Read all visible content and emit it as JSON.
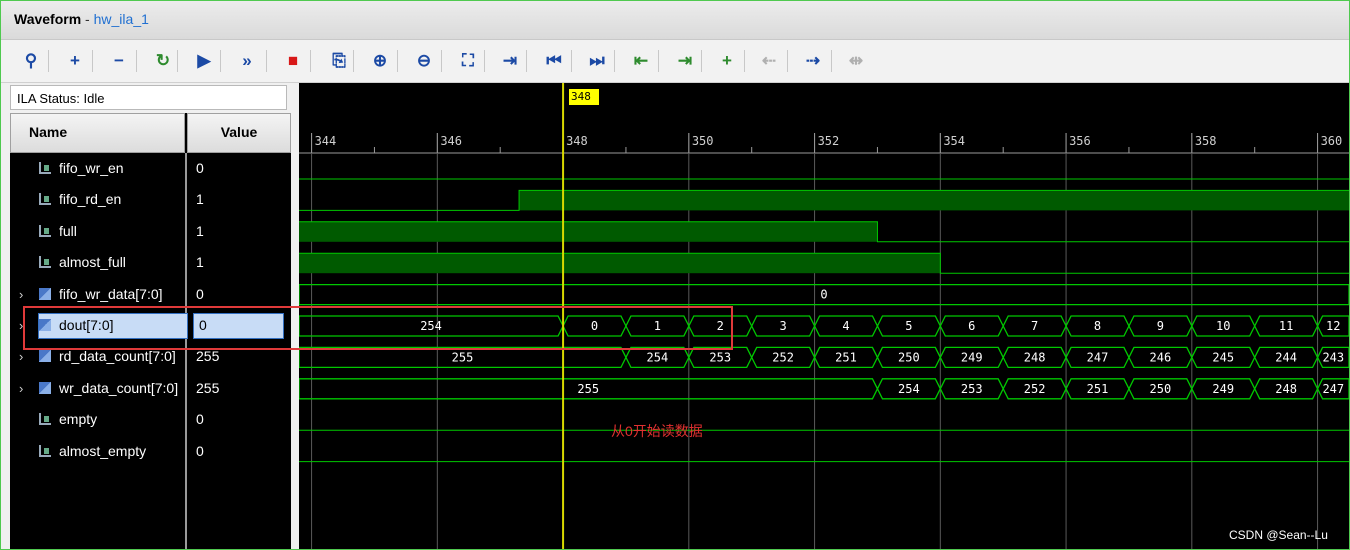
{
  "window": {
    "title": "Waveform",
    "separator": " - ",
    "instance": "hw_ila_1"
  },
  "toolbar": {
    "buttons": [
      {
        "name": "search-icon",
        "glyph": "⚲"
      },
      {
        "name": "add-icon",
        "glyph": "+"
      },
      {
        "name": "remove-icon",
        "glyph": "−"
      },
      {
        "name": "refresh-icon",
        "glyph": "↻"
      },
      {
        "name": "run-trigger-icon",
        "glyph": "▶"
      },
      {
        "name": "run-immediate-icon",
        "glyph": "»"
      },
      {
        "name": "stop-icon",
        "glyph": "■"
      },
      {
        "name": "export-icon",
        "glyph": "⎘"
      },
      {
        "name": "zoom-in-icon",
        "glyph": "⊕"
      },
      {
        "name": "zoom-out-icon",
        "glyph": "⊖"
      },
      {
        "name": "zoom-fit-icon",
        "glyph": "⛶"
      },
      {
        "name": "go-to-cursor-icon",
        "glyph": "⇥"
      },
      {
        "name": "go-to-start-icon",
        "glyph": "⏮"
      },
      {
        "name": "go-to-end-icon",
        "glyph": "⏭"
      },
      {
        "name": "previous-transition-icon",
        "glyph": "⇤"
      },
      {
        "name": "next-transition-icon",
        "glyph": "⇥"
      },
      {
        "name": "add-marker-icon",
        "glyph": "+"
      },
      {
        "name": "previous-marker-icon",
        "glyph": "⇠"
      },
      {
        "name": "next-marker-icon",
        "glyph": "⇢"
      },
      {
        "name": "swap-cursors-icon",
        "glyph": "⇹"
      }
    ]
  },
  "status": {
    "text": "ILA Status: Idle"
  },
  "columns": {
    "name": "Name",
    "value": "Value"
  },
  "signals": [
    {
      "name": "fifo_wr_en",
      "value": "0",
      "type": "bit"
    },
    {
      "name": "fifo_rd_en",
      "value": "1",
      "type": "bit"
    },
    {
      "name": "full",
      "value": "1",
      "type": "bit"
    },
    {
      "name": "almost_full",
      "value": "1",
      "type": "bit"
    },
    {
      "name": "fifo_wr_data[7:0]",
      "value": "0",
      "type": "bus"
    },
    {
      "name": "dout[7:0]",
      "value": "0",
      "type": "bus",
      "selected": true
    },
    {
      "name": "rd_data_count[7:0]",
      "value": "255",
      "type": "bus"
    },
    {
      "name": "wr_data_count[7:0]",
      "value": "255",
      "type": "bus"
    },
    {
      "name": "empty",
      "value": "0",
      "type": "bit"
    },
    {
      "name": "almost_empty",
      "value": "0",
      "type": "bit"
    }
  ],
  "timeline": {
    "start": 343.8,
    "end": 360.5,
    "ticks": [
      344,
      346,
      348,
      350,
      352,
      354,
      356,
      358,
      360
    ],
    "cursor": 348,
    "cursor_label": "348"
  },
  "waveforms": {
    "fifo_wr_en": [
      [
        343.8,
        0
      ]
    ],
    "fifo_rd_en": [
      [
        343.8,
        0
      ],
      [
        347.3,
        1
      ]
    ],
    "full": [
      [
        343.8,
        1
      ],
      [
        353.0,
        0
      ]
    ],
    "almost_full": [
      [
        343.8,
        1
      ],
      [
        354.0,
        0
      ]
    ],
    "fifo_wr_data[7:0]": [
      [
        343.8,
        "0"
      ]
    ],
    "dout[7:0]": [
      [
        343.8,
        "254"
      ],
      [
        348,
        "0"
      ],
      [
        349,
        "1"
      ],
      [
        350,
        "2"
      ],
      [
        351,
        "3"
      ],
      [
        352,
        "4"
      ],
      [
        353,
        "5"
      ],
      [
        354,
        "6"
      ],
      [
        355,
        "7"
      ],
      [
        356,
        "8"
      ],
      [
        357,
        "9"
      ],
      [
        358,
        "10"
      ],
      [
        359,
        "11"
      ],
      [
        360,
        "12"
      ]
    ],
    "rd_data_count[7:0]": [
      [
        343.8,
        "255"
      ],
      [
        349,
        "254"
      ],
      [
        350,
        "253"
      ],
      [
        351,
        "252"
      ],
      [
        352,
        "251"
      ],
      [
        353,
        "250"
      ],
      [
        354,
        "249"
      ],
      [
        355,
        "248"
      ],
      [
        356,
        "247"
      ],
      [
        357,
        "246"
      ],
      [
        358,
        "245"
      ],
      [
        359,
        "244"
      ],
      [
        360,
        "243"
      ]
    ],
    "wr_data_count[7:0]": [
      [
        343.8,
        "255"
      ],
      [
        353,
        "254"
      ],
      [
        354,
        "253"
      ],
      [
        355,
        "252"
      ],
      [
        356,
        "251"
      ],
      [
        357,
        "250"
      ],
      [
        358,
        "249"
      ],
      [
        359,
        "248"
      ],
      [
        360,
        "247"
      ]
    ],
    "empty": [
      [
        343.8,
        0
      ]
    ],
    "almost_empty": [
      [
        343.8,
        0
      ]
    ]
  },
  "annotation": {
    "note": "从0开始读数据"
  },
  "watermark": "CSDN @Sean--Lu",
  "colors": {
    "wave": "#00c800",
    "wave_fill": "#005a00",
    "cursor": "#d8d800",
    "highlight": "#e03a3a",
    "background": "#000000"
  }
}
